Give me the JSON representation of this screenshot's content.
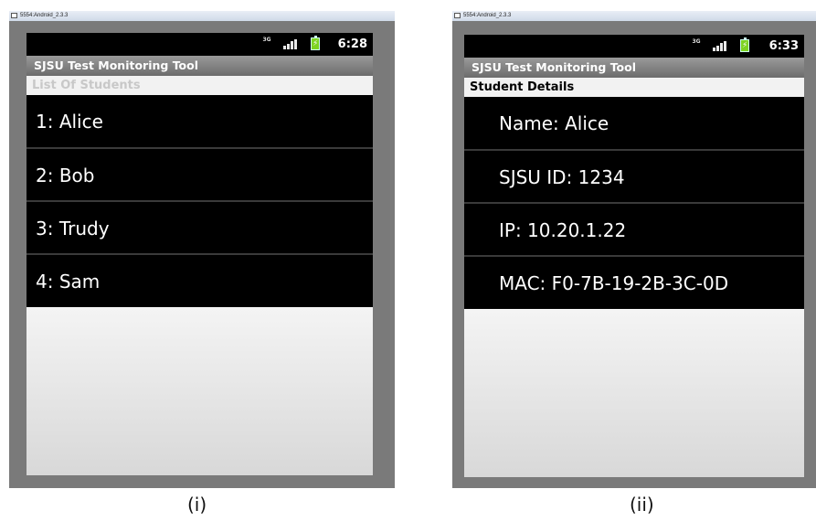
{
  "left": {
    "window_title": "5554:Android_2.3.3",
    "status": {
      "clock": "6:28",
      "network_icon_text": "3G"
    },
    "app_title": "SJSU Test Monitoring Tool",
    "subheader": "List Of Students",
    "items": [
      {
        "label": "1: Alice"
      },
      {
        "label": "2: Bob"
      },
      {
        "label": "3: Trudy"
      },
      {
        "label": "4: Sam"
      }
    ],
    "caption": "(i)"
  },
  "right": {
    "window_title": "5554:Android_2.3.3",
    "status": {
      "clock": "6:33",
      "network_icon_text": "3G"
    },
    "app_title": "SJSU Test Monitoring Tool",
    "subheader": "Student Details",
    "details": [
      {
        "label": "Name:  Alice"
      },
      {
        "label": "SJSU ID:  1234"
      },
      {
        "label": "IP:   10.20.1.22"
      },
      {
        "label": "MAC:  F0-7B-19-2B-3C-0D"
      }
    ],
    "caption": "(ii)"
  },
  "colors": {
    "screen_bg": "#000000",
    "titlebar": "#7d7d7d",
    "battery": "#7ed321",
    "emulator_frame": "#7a7a7a"
  }
}
